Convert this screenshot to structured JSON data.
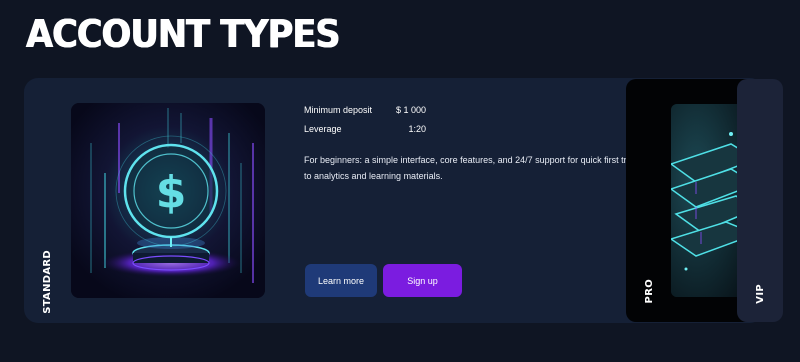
{
  "page": {
    "title": "ACCOUNT TYPES"
  },
  "accounts": {
    "standard": {
      "tab_label": "STANDARD",
      "details": [
        {
          "label": "Minimum deposit",
          "value": "$ 1 000"
        },
        {
          "label": "Leverage",
          "value": "1:20"
        }
      ],
      "description_line1": "For beginners: a simple interface, core features, and 24/7 support for quick first trade",
      "description_line2": "to analytics and learning materials.",
      "learn_more_label": "Learn more",
      "sign_up_label": "Sign up",
      "hero_icon": "dollar-coin-hologram"
    },
    "pro": {
      "tab_label": "PRO",
      "hero_icon": "book-stack"
    },
    "vip": {
      "tab_label": "VIP"
    }
  },
  "colors": {
    "background": "#0f1523",
    "card": "#152036",
    "learn_more_button": "#1f3a78",
    "sign_up_button": "#7b1ce0",
    "pro_card": "#020305",
    "vip_card": "#1c2338"
  }
}
